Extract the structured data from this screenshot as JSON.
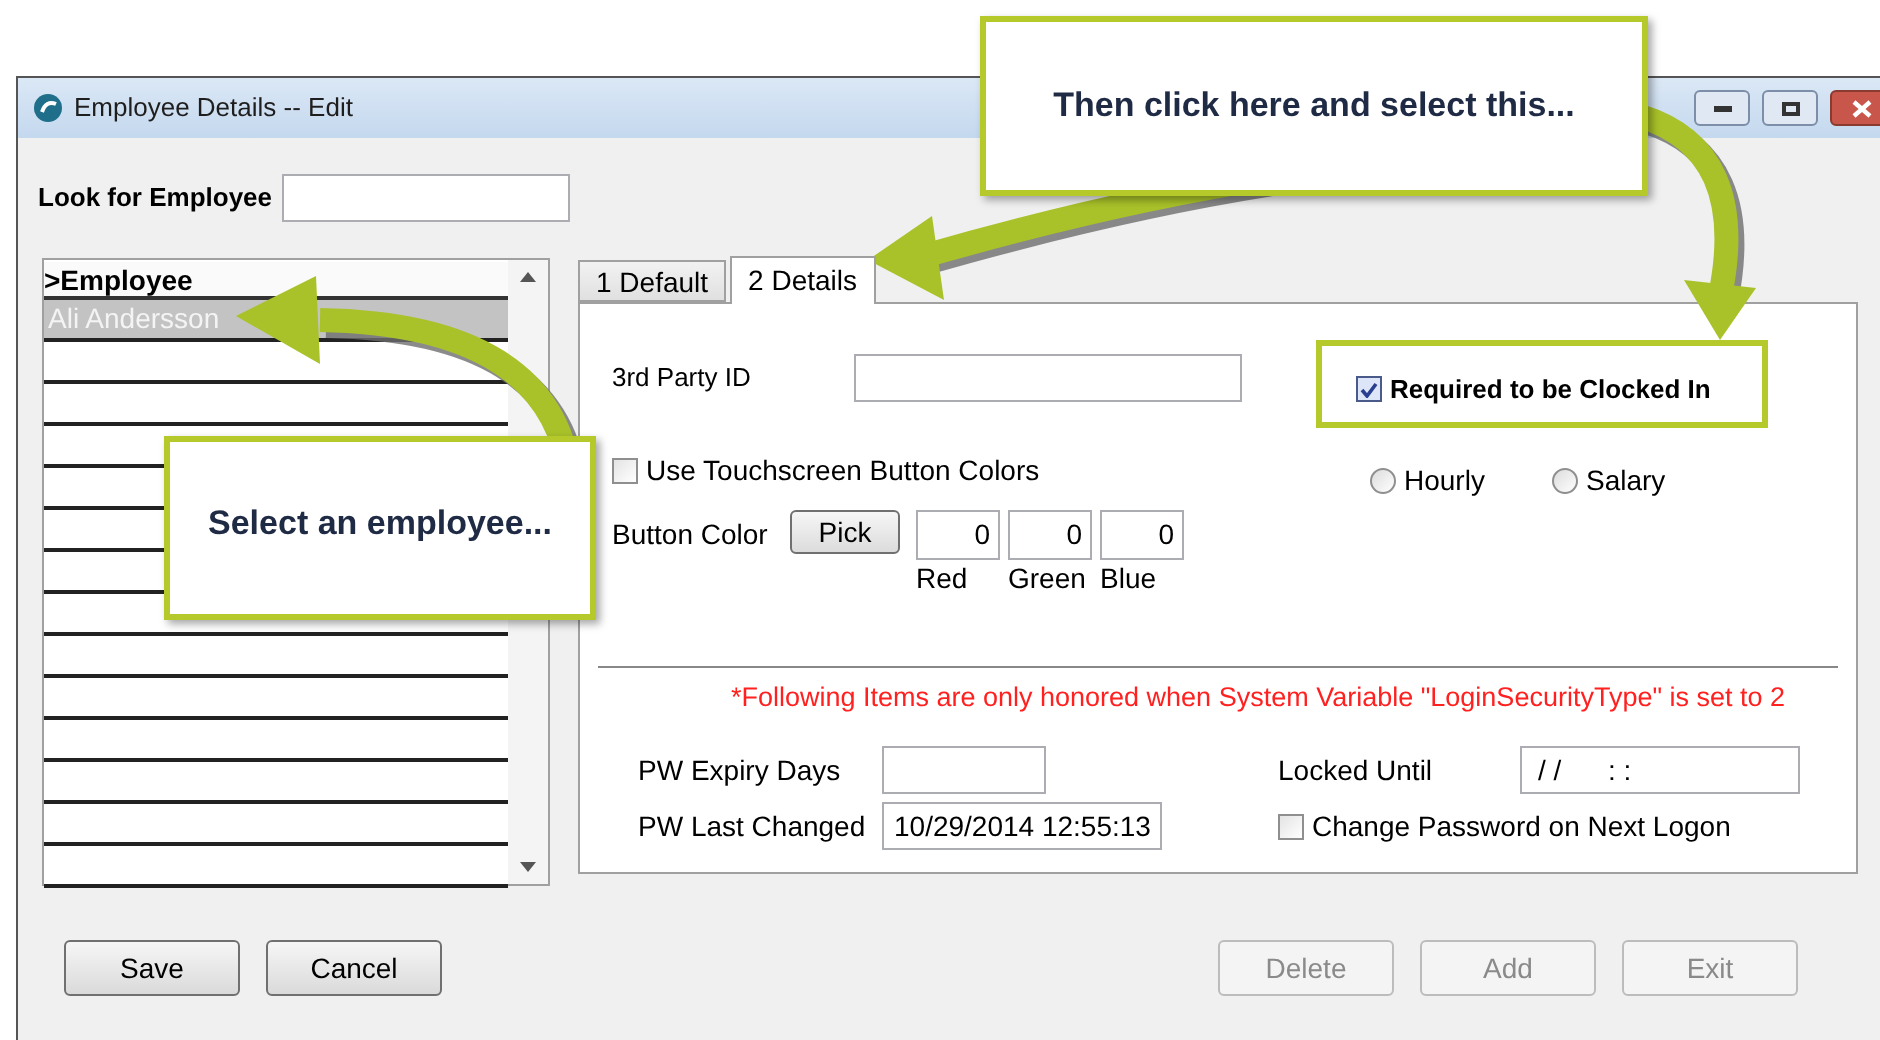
{
  "window": {
    "title": "Employee Details -- Edit"
  },
  "search": {
    "label": "Look for Employee"
  },
  "employee_list": {
    "header": ">Employee",
    "rows": [
      {
        "name": "Ali Andersson",
        "selected": true
      }
    ]
  },
  "tabs": [
    {
      "label": "1 Default",
      "selected": false
    },
    {
      "label": "2 Details",
      "selected": true
    }
  ],
  "details": {
    "third_party_id": {
      "label": "3rd Party ID"
    },
    "required_clocked_in": {
      "label": "Required to be Clocked In",
      "checked": true
    },
    "pay_type": [
      {
        "label": "Hourly",
        "selected": false
      },
      {
        "label": "Salary",
        "selected": false
      }
    ],
    "use_touchscreen_colors": {
      "label": "Use Touchscreen Button Colors",
      "checked": false
    },
    "button_color": {
      "label": "Button Color",
      "pick_button": {
        "label": "Pick"
      },
      "channels": [
        {
          "label": "Red",
          "value": "0"
        },
        {
          "label": "Green",
          "value": "0"
        },
        {
          "label": "Blue",
          "value": "0"
        }
      ]
    },
    "note": "*Following Items are only honored when System Variable \"LoginSecurityType\" is set to 2",
    "pw_expiry_days": {
      "label": "PW Expiry Days"
    },
    "locked_until": {
      "label": "Locked Until",
      "value": "/ /      : :"
    },
    "pw_last_changed": {
      "label": "PW Last Changed",
      "value": "10/29/2014 12:55:13"
    },
    "change_password": {
      "label": "Change Password on Next Logon",
      "checked": false
    }
  },
  "buttons": [
    {
      "label": "Save",
      "disabled": false
    },
    {
      "label": "Cancel",
      "disabled": false
    },
    {
      "label": "Delete",
      "disabled": true
    },
    {
      "label": "Add",
      "disabled": true
    },
    {
      "label": "Exit",
      "disabled": true
    }
  ],
  "callouts": [
    {
      "text": "Then click here and select this..."
    },
    {
      "text": "Select an employee..."
    }
  ]
}
